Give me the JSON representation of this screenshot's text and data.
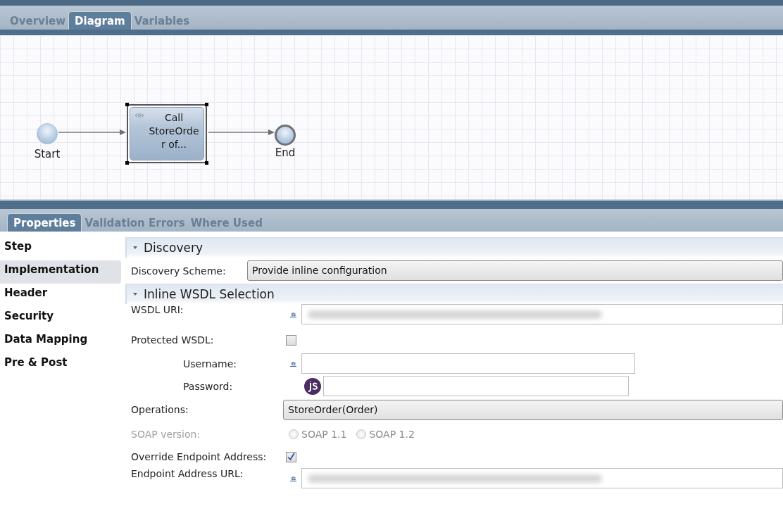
{
  "editor_tabs": [
    {
      "label": "Overview",
      "selected": false
    },
    {
      "label": "Diagram",
      "selected": true
    },
    {
      "label": "Variables",
      "selected": false
    }
  ],
  "diagram": {
    "nodes": [
      {
        "kind": "start",
        "label": "Start"
      },
      {
        "kind": "task",
        "label_lines": [
          "Call",
          "StoreOrde",
          "r of..."
        ],
        "selected": true
      },
      {
        "kind": "end",
        "label": "End"
      }
    ]
  },
  "panel_tabs": [
    {
      "label": "Properties",
      "selected": true
    },
    {
      "label": "Validation Errors",
      "selected": false
    },
    {
      "label": "Where Used",
      "selected": false
    }
  ],
  "nav_items": [
    {
      "label": "Step",
      "selected": false
    },
    {
      "label": "Implementation",
      "selected": true
    },
    {
      "label": "Header",
      "selected": false
    },
    {
      "label": "Security",
      "selected": false
    },
    {
      "label": "Data Mapping",
      "selected": false
    },
    {
      "label": "Pre & Post",
      "selected": false
    }
  ],
  "sections": [
    {
      "title": "Discovery",
      "expanded": true,
      "rows": [
        {
          "kind": "dropdown",
          "label": "Discovery Scheme:",
          "value": "Provide inline configuration"
        }
      ]
    },
    {
      "title": "Inline WSDL Selection",
      "expanded": true,
      "rows": [
        {
          "kind": "text",
          "label": "WSDL URI:",
          "redacted": true
        },
        {
          "kind": "checkbox",
          "label": "Protected WSDL:",
          "checked": false,
          "children": [
            {
              "kind": "text",
              "label": "Username:",
              "redacted": false
            },
            {
              "kind": "script",
              "label": "Password:",
              "redacted": false
            }
          ]
        },
        {
          "kind": "dropdown",
          "label": "Operations:",
          "value": "StoreOrder(Order)"
        },
        {
          "kind": "radio",
          "label": "SOAP version:",
          "disabled": true,
          "options": [
            {
              "label": "SOAP 1.1",
              "selected": false
            },
            {
              "label": "SOAP 1.2",
              "selected": false
            }
          ]
        },
        {
          "kind": "checkbox",
          "label": "Override Endpoint Address:",
          "checked": true
        },
        {
          "kind": "text",
          "label": "Endpoint Address URL:",
          "redacted": true
        }
      ]
    }
  ]
}
